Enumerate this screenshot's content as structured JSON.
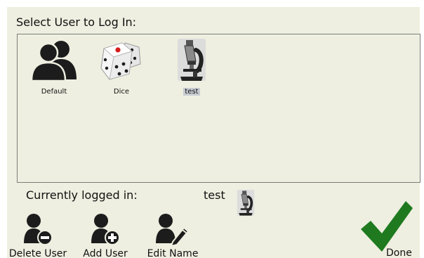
{
  "header": {
    "title": "Select User to Log In:"
  },
  "users": [
    {
      "name": "Default",
      "icon": "users-icon",
      "selected": false
    },
    {
      "name": "Dice",
      "icon": "dice-icon",
      "selected": false
    },
    {
      "name": "test",
      "icon": "microscope-icon",
      "selected": true
    }
  ],
  "status": {
    "label": "Currently logged in:",
    "current_user": "test",
    "current_icon": "microscope-icon"
  },
  "actions": {
    "delete_label": "Delete User",
    "add_label": "Add User",
    "edit_label": "Edit Name",
    "done_label": "Done"
  },
  "colors": {
    "background": "#eeefe0",
    "border": "#7b7f7b",
    "icon_dark": "#1c1c1c",
    "check_green": "#1f7a1f",
    "selection": "#c7cbd2"
  }
}
